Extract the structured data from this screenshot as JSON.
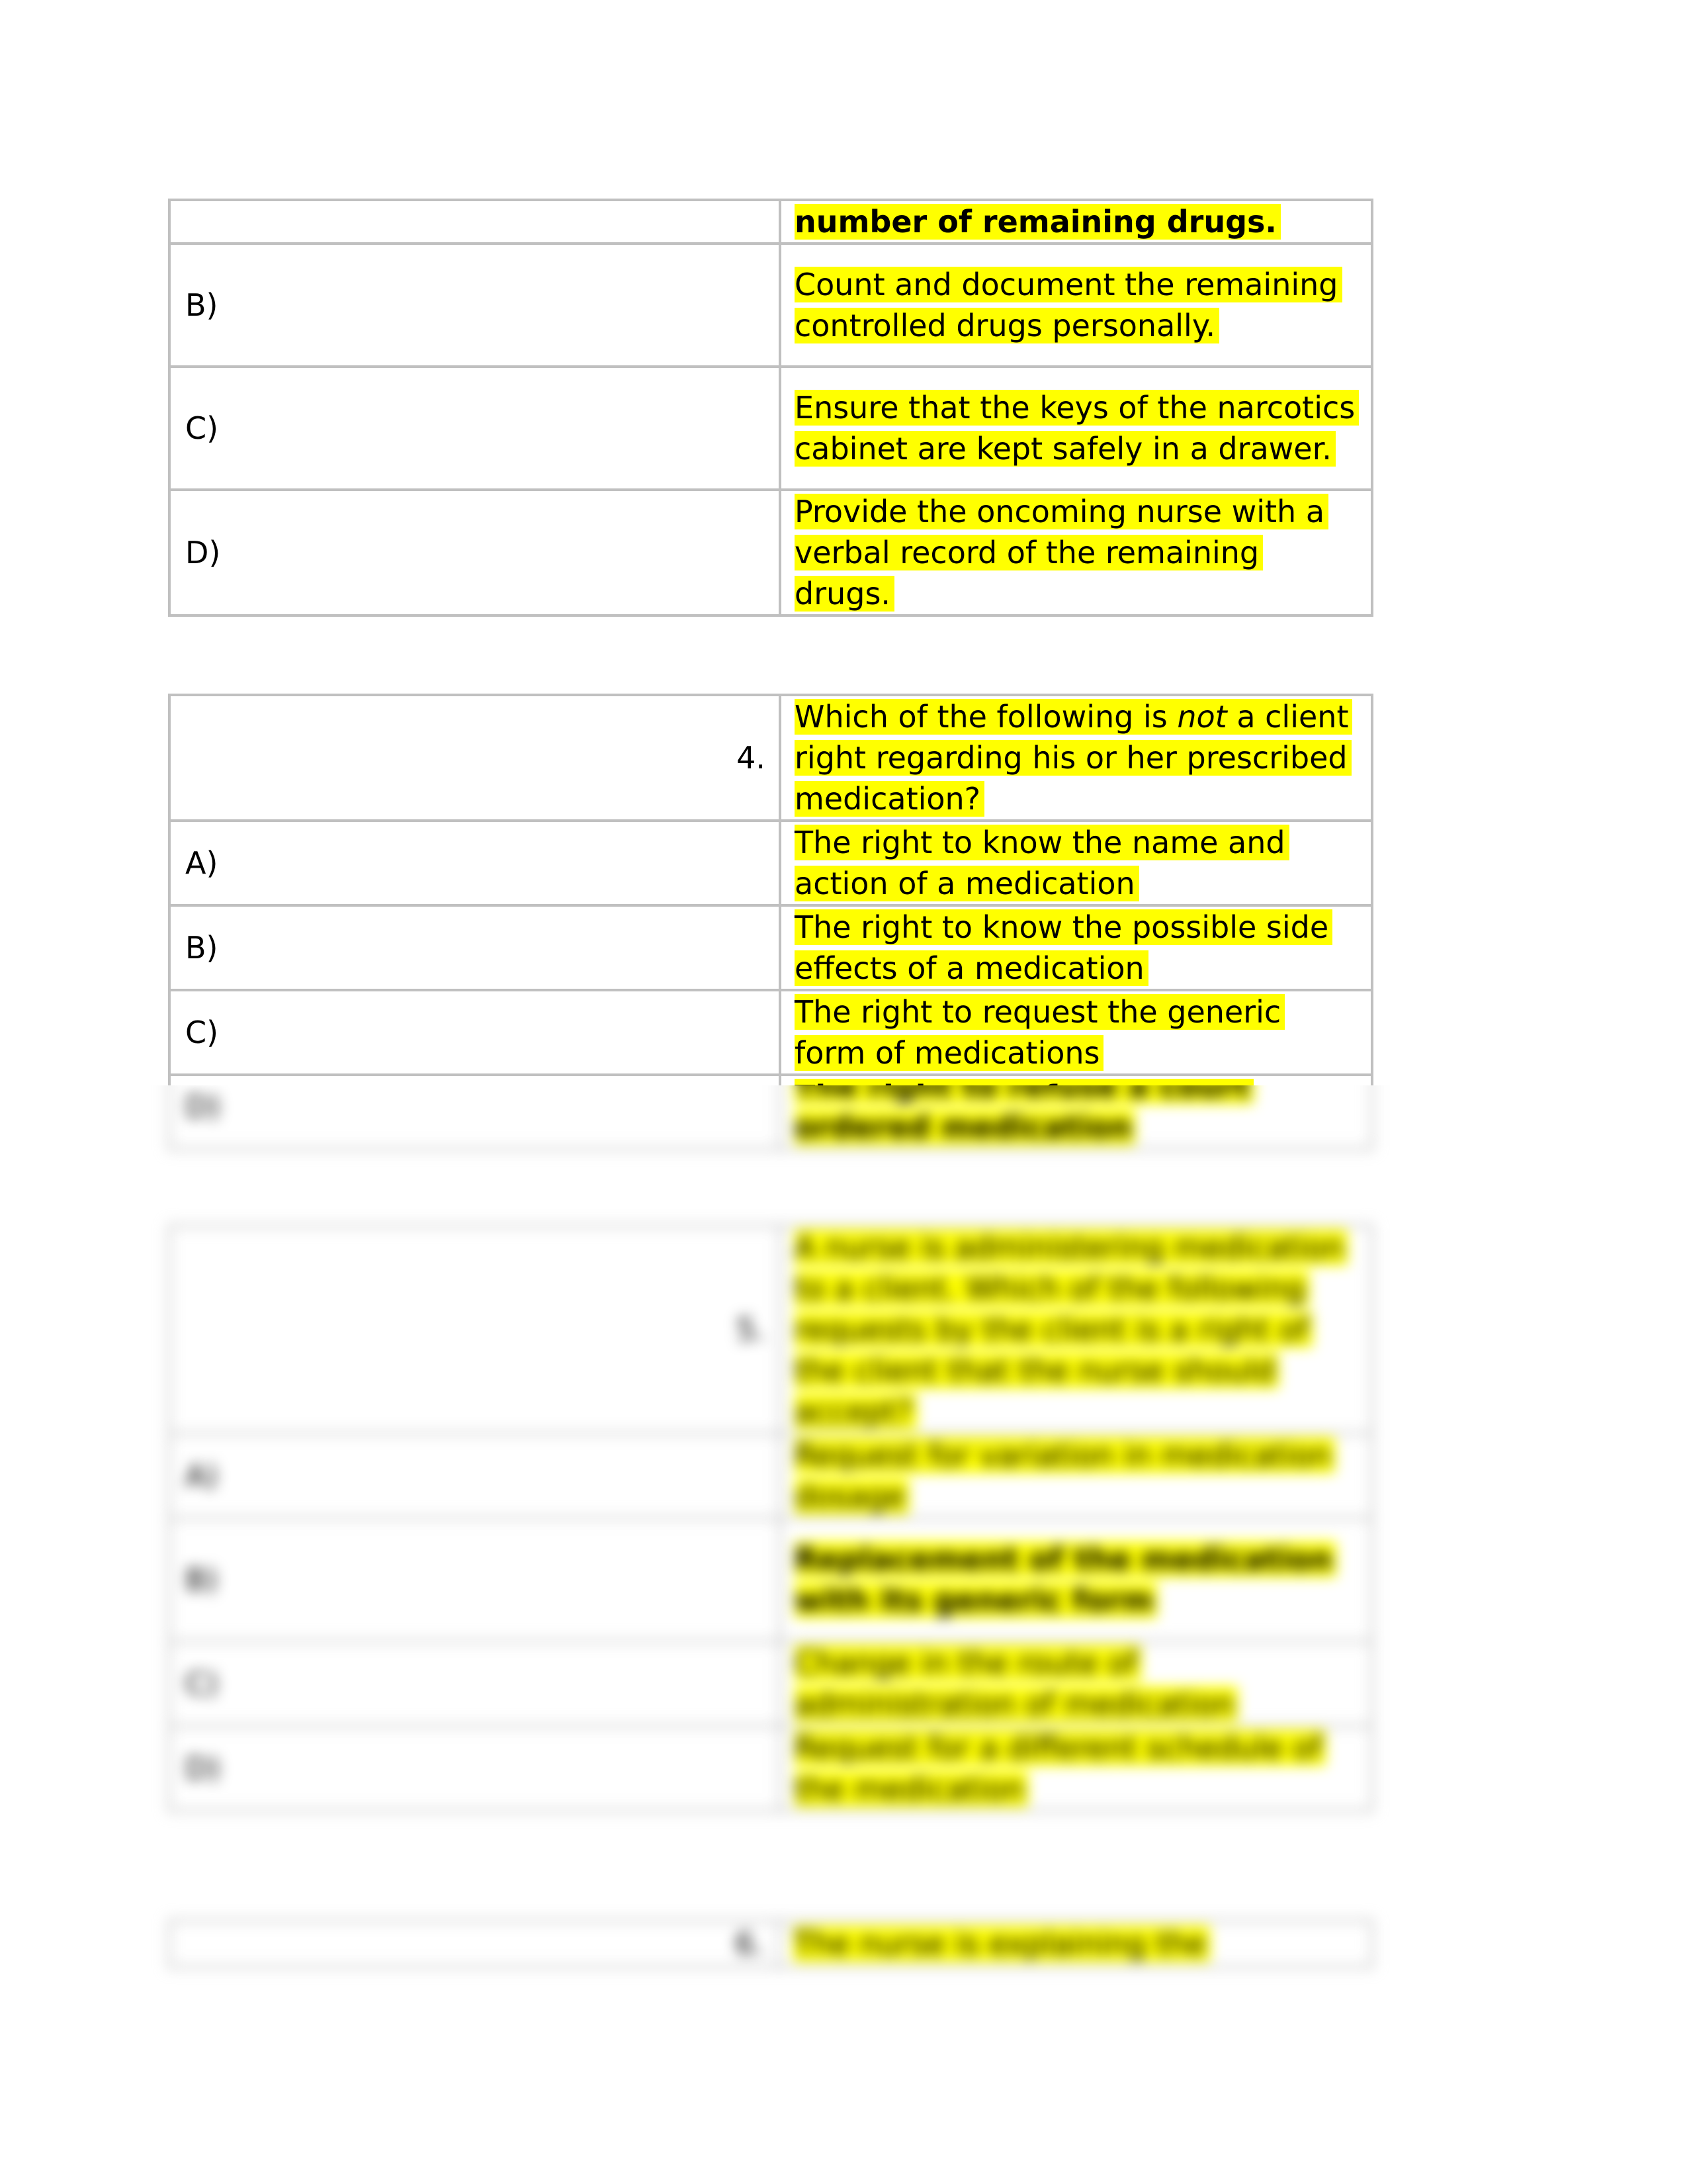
{
  "table1": {
    "rows": [
      {
        "label": "",
        "text": "number of remaining drugs.",
        "bold": true
      },
      {
        "label": "B)",
        "text": "Count and document the remaining controlled drugs personally.",
        "bold": false
      },
      {
        "label": "C)",
        "text": "Ensure that the keys of the narcotics cabinet are kept safely in a drawer.",
        "bold": false
      },
      {
        "label": "D)",
        "text": "Provide the oncoming nurse with a verbal record of the remaining drugs.",
        "bold": false
      }
    ]
  },
  "question4": {
    "number": "4.",
    "question_before": "Which of the following is ",
    "question_emph": "not",
    "question_after": " a client right regarding his or her prescribed medication?",
    "options": [
      {
        "label": "A)",
        "text": "The right to know the name and action of a medication",
        "bold": false
      },
      {
        "label": "B)",
        "text": "The right to know the possible side effects of a medication",
        "bold": false
      },
      {
        "label": "C)",
        "text": "The right to request the generic form of medications",
        "bold": false
      },
      {
        "label": "D)",
        "text": "The right to refuse a court ordered medication",
        "bold": true
      }
    ]
  },
  "question5": {
    "number": "5.",
    "question": "A nurse is administering medication to a client. Which of the following requests by the client is a right of the client that the nurse should accept?",
    "options": [
      {
        "label": "A)",
        "text": "Request for variation in medication dosage",
        "bold": false
      },
      {
        "label": "B)",
        "text": "Replacement of the medication with its generic form",
        "bold": true
      },
      {
        "label": "C)",
        "text": "Change in the route of administration of medication",
        "bold": false
      },
      {
        "label": "D)",
        "text": "Request for a different schedule of the medication",
        "bold": false
      }
    ]
  },
  "question6": {
    "number": "6.",
    "question": "The nurse is explaining the"
  },
  "colors": {
    "highlight": "#ffff00",
    "border": "#c0c0c0"
  }
}
